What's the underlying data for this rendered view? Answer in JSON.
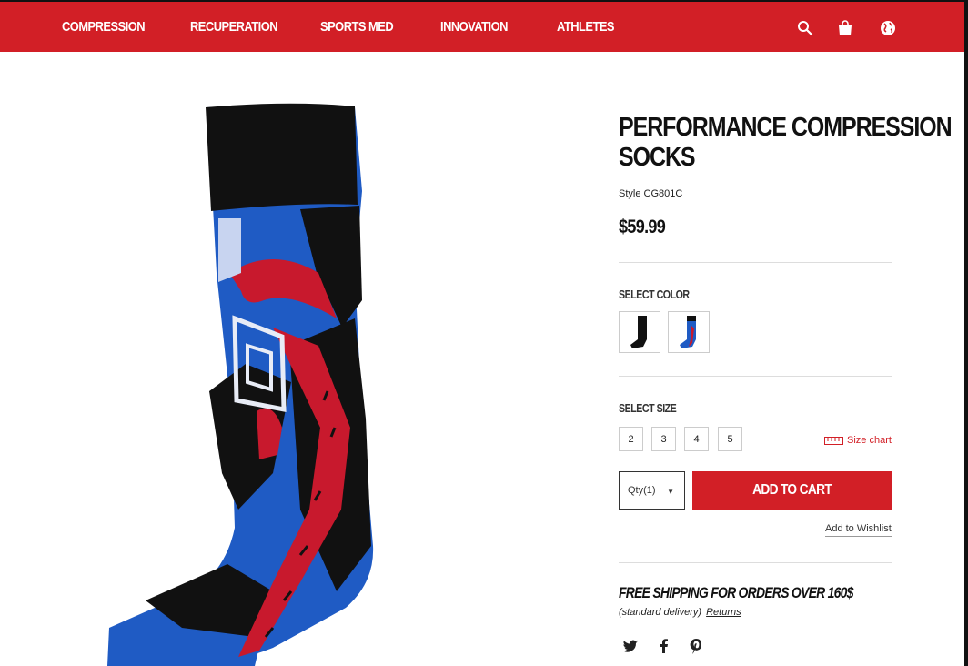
{
  "nav": {
    "items": [
      "COMPRESSION",
      "RECUPERATION",
      "SPORTS MED",
      "INNOVATION",
      "ATHLETES"
    ],
    "icons": [
      "search-icon",
      "shopping-bag-icon",
      "globe-icon"
    ]
  },
  "product": {
    "title_line1": "PERFORMANCE COMPRESSION",
    "title_line2": "SOCKS",
    "style": "Style CG801C",
    "price": "$59.99",
    "select_color_label": "SELECT COLOR",
    "colors": [
      "black",
      "black/blue/red"
    ],
    "select_size_label": "SELECT SIZE",
    "sizes": [
      "2",
      "3",
      "4",
      "5"
    ],
    "size_chart_label": "Size chart",
    "qty_label": "Qty(1)",
    "add_to_cart_label": "ADD TO CART",
    "wishlist_label": "Add to Wishlist",
    "shipping_title": "FREE SHIPPING FOR ORDERS OVER 160$",
    "delivery_note": "(standard delivery)",
    "returns_label": "Returns",
    "social": [
      "twitter-icon",
      "facebook-icon",
      "pinterest-icon"
    ]
  },
  "colors": {
    "brand_red": "#d21f26",
    "sock_blue": "#1f5bc4",
    "sock_black": "#111111"
  }
}
